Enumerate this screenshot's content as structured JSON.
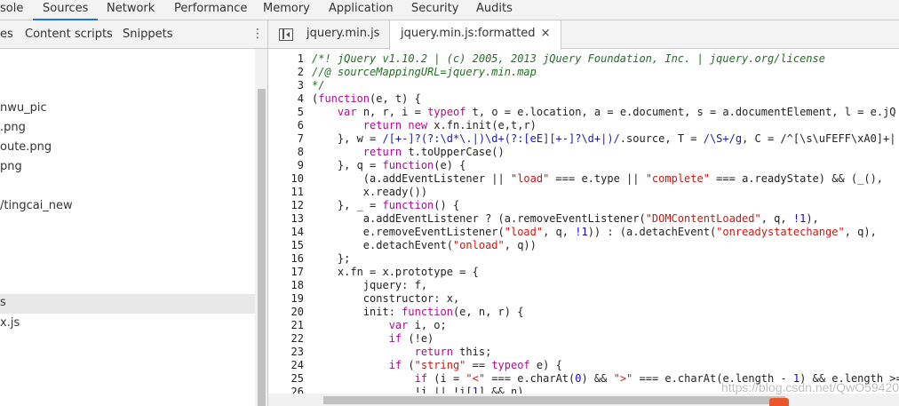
{
  "top_tabs": [
    "sole",
    "Sources",
    "Network",
    "Performance",
    "Memory",
    "Application",
    "Security",
    "Audits"
  ],
  "active_top_tab": "Sources",
  "nav_tabs": [
    "es",
    "Content scripts",
    "Snippets"
  ],
  "nav_more_icon": "more-vertical-icon",
  "tree_items": [
    "nwu_pic",
    ".png",
    "oute.png",
    "png",
    "/tingcai_new",
    "s",
    "x.js"
  ],
  "editor_tabs": {
    "first": "jquery.min.js",
    "second": "jquery.min.js:formatted",
    "close": "×"
  },
  "code_lines": [
    "/*! jQuery v1.10.2 | (c) 2005, 2013 jQuery Foundation, Inc. | jquery.org/license",
    "//@ sourceMappingURL=jquery.min.map",
    "*/",
    "(function(e, t) {",
    "    var n, r, i = typeof t, o = e.location, a = e.document, s = a.documentElement, l = e.jQ",
    "        return new x.fn.init(e,t,r)",
    "    }, w = /[+-]?(?:\\d*\\.|)\\d+(?:[eE][+-]?\\d+|)/.source, T = /\\S+/g, C = /^[\\s\\uFEFF\\xA0]+|",
    "        return t.toUpperCase()",
    "    }, q = function(e) {",
    "        (a.addEventListener || \"load\" === e.type || \"complete\" === a.readyState) && (_(),",
    "        x.ready())",
    "    }, _ = function() {",
    "        a.addEventListener ? (a.removeEventListener(\"DOMContentLoaded\", q, !1),",
    "        e.removeEventListener(\"load\", q, !1)) : (a.detachEvent(\"onreadystatechange\", q),",
    "        e.detachEvent(\"onload\", q))",
    "    };",
    "    x.fn = x.prototype = {",
    "        jquery: f,",
    "        constructor: x,",
    "        init: function(e, n, r) {",
    "            var i, o;",
    "            if (!e)",
    "                return this;",
    "            if (\"string\" == typeof e) {",
    "                if (i = \"<\" === e.charAt(0) && \">\" === e.charAt(e.length - 1) && e.length >=",
    "                !i || !i[1] && n)",
    ""
  ],
  "watermark": "https://blog.csdn.net/QwO59420"
}
